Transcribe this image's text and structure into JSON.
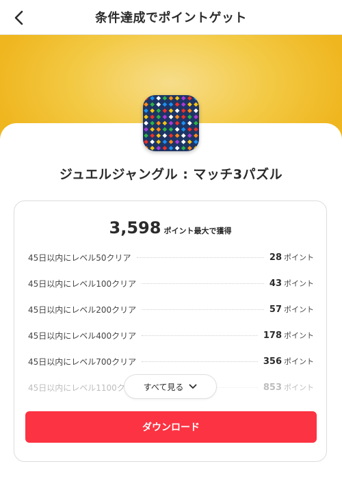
{
  "header": {
    "title": "条件達成でポイントゲット"
  },
  "app": {
    "name": "ジュエルジャングル : マッチ3パズル"
  },
  "reward": {
    "total_points": "3,598",
    "total_label": "ポイント最大で獲得"
  },
  "missions": [
    {
      "label": "45日以内にレベル50クリア",
      "points": "28",
      "unit": "ポイント"
    },
    {
      "label": "45日以内にレベル100クリア",
      "points": "43",
      "unit": "ポイント"
    },
    {
      "label": "45日以内にレベル200クリア",
      "points": "57",
      "unit": "ポイント"
    },
    {
      "label": "45日以内にレベル400クリア",
      "points": "178",
      "unit": "ポイント"
    },
    {
      "label": "45日以内にレベル700クリア",
      "points": "356",
      "unit": "ポイント"
    },
    {
      "label": "45日以内にレベル1100ク",
      "points": "853",
      "unit": "ポイント"
    }
  ],
  "see_all": {
    "label": "すべて見る",
    "icon": "chevron-down-icon"
  },
  "download": {
    "label": "ダウンロード"
  },
  "colors": {
    "banner": "#f3c944",
    "download": "#fc3342",
    "text": "#2b2b2b"
  }
}
